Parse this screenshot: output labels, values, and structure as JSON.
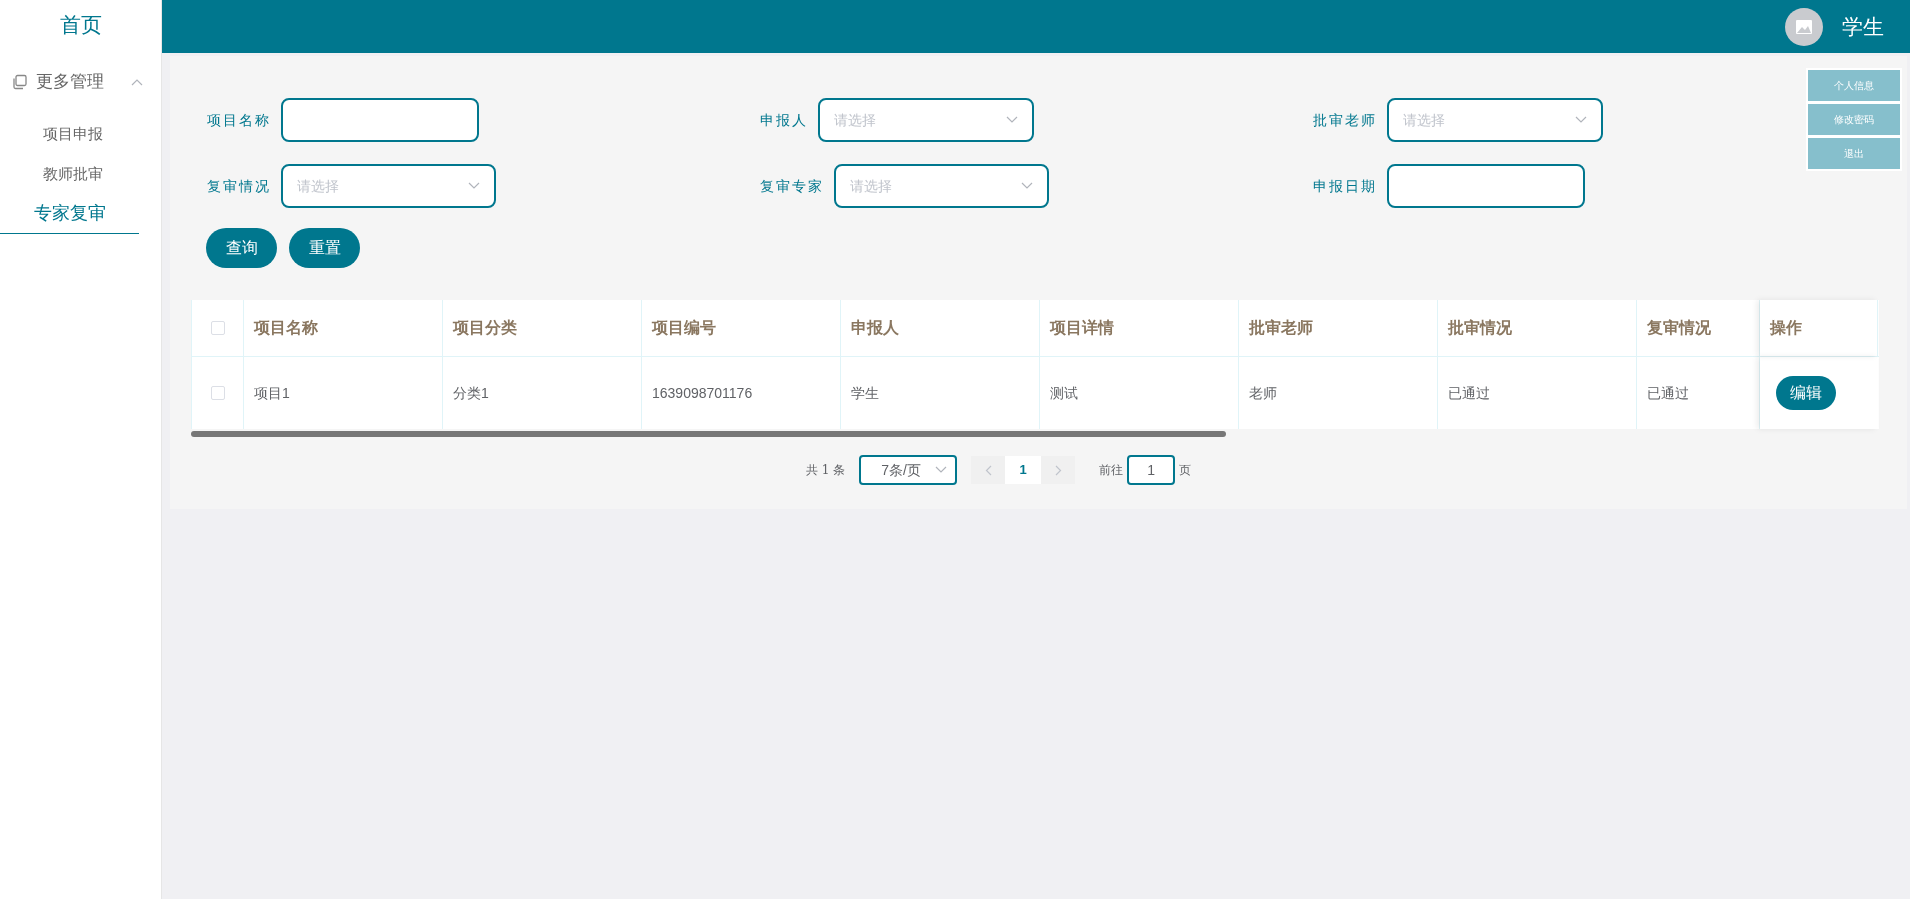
{
  "sidebar": {
    "home": "首页",
    "groups": [
      {
        "label": "更多管理",
        "expanded": true,
        "children": [
          {
            "label": "项目申报",
            "selected": false
          },
          {
            "label": "教师批审",
            "selected": false
          },
          {
            "label": "专家复审",
            "selected": true
          }
        ]
      }
    ]
  },
  "header": {
    "user": "学生"
  },
  "user_menu": {
    "items": [
      "个人信息",
      "修改密码",
      "退出"
    ]
  },
  "filters": [
    {
      "label": "项目名称",
      "kind": "text"
    },
    {
      "label": "申报人",
      "kind": "select",
      "placeholder": "请选择"
    },
    {
      "label": "批审老师",
      "kind": "select",
      "placeholder": "请选择"
    },
    {
      "label": "复审情况",
      "kind": "select",
      "placeholder": "请选择"
    },
    {
      "label": "复审专家",
      "kind": "select",
      "placeholder": "请选择"
    },
    {
      "label": "申报日期",
      "kind": "text"
    }
  ],
  "buttons": [
    "查询",
    "重置"
  ],
  "table": {
    "all_checked": false,
    "columns": [
      "项目名称",
      "项目分类",
      "项目编号",
      "申报人",
      "项目详情",
      "批审老师",
      "批审情况",
      "复审情况",
      "操作"
    ],
    "rows": [
      {
        "selected": false,
        "cells": [
          "项目1",
          "分类1",
          "1639098701176",
          "学生",
          "测试",
          "老师",
          "已通过",
          "已通过"
        ],
        "action": "编辑"
      }
    ]
  },
  "pagination": {
    "total": "共 1 条",
    "page_size": "7条/页",
    "pages": [
      {
        "label": "1",
        "selected": true
      }
    ],
    "goto_label": "前往",
    "goto_value": "1",
    "goto_suffix": "页"
  }
}
